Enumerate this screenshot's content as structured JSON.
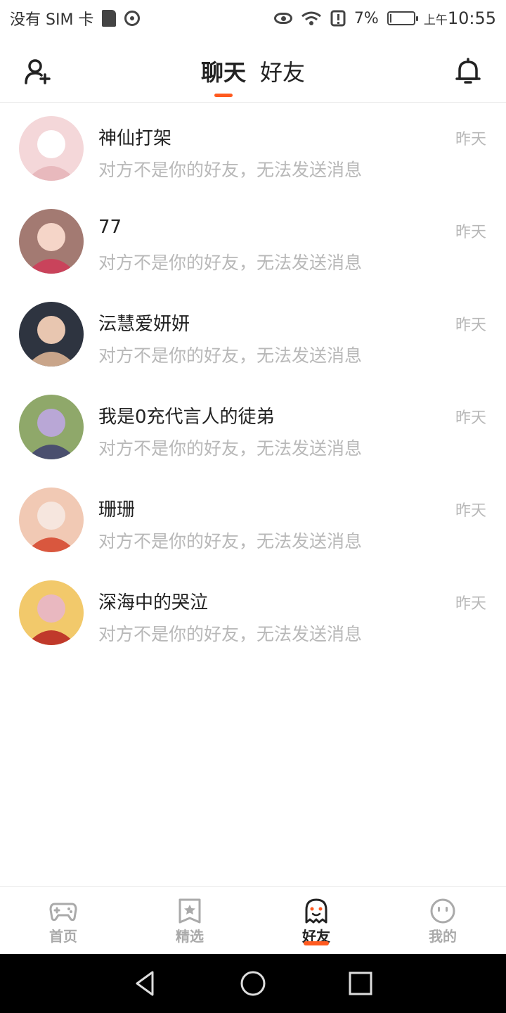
{
  "status_bar": {
    "carrier": "没有 SIM 卡",
    "battery_percent": "7%",
    "battery_level": 0.07,
    "time_prefix": "上午",
    "time": "10:55"
  },
  "header": {
    "tabs": [
      {
        "label": "聊天",
        "active": true
      },
      {
        "label": "好友",
        "active": false
      }
    ]
  },
  "chats": [
    {
      "name": "神仙打架",
      "message": "对方不是你的好友，无法发送消息",
      "time": "昨天",
      "avatar_colors": [
        "#f4d7d9",
        "#e8b9bd",
        "#ffffff"
      ]
    },
    {
      "name": "77",
      "message": "对方不是你的好友，无法发送消息",
      "time": "昨天",
      "avatar_colors": [
        "#a37a72",
        "#c9435b",
        "#f5d5c8"
      ]
    },
    {
      "name": "沄慧爱妍妍",
      "message": "对方不是你的好友，无法发送消息",
      "time": "昨天",
      "avatar_colors": [
        "#2e3440",
        "#c9a58a",
        "#e8c6b0"
      ]
    },
    {
      "name": "我是0充代言人的徒弟",
      "message": "对方不是你的好友，无法发送消息",
      "time": "昨天",
      "avatar_colors": [
        "#8fa86a",
        "#4a4f6e",
        "#b9a7d6"
      ]
    },
    {
      "name": "珊珊",
      "message": "对方不是你的好友，无法发送消息",
      "time": "昨天",
      "avatar_colors": [
        "#f1c9b4",
        "#d9573e",
        "#f6e6de"
      ]
    },
    {
      "name": "深海中的哭泣",
      "message": "对方不是你的好友，无法发送消息",
      "time": "昨天",
      "avatar_colors": [
        "#f2c96b",
        "#c0392b",
        "#e9b8c0"
      ]
    }
  ],
  "bottom_nav": [
    {
      "label": "首页",
      "icon": "gamepad-icon",
      "active": false
    },
    {
      "label": "精选",
      "icon": "star-bookmark-icon",
      "active": false
    },
    {
      "label": "好友",
      "icon": "ghost-icon",
      "active": true
    },
    {
      "label": "我的",
      "icon": "face-icon",
      "active": false
    }
  ],
  "colors": {
    "accent": "#ff5a1f",
    "muted_text": "#b8b8b8"
  }
}
